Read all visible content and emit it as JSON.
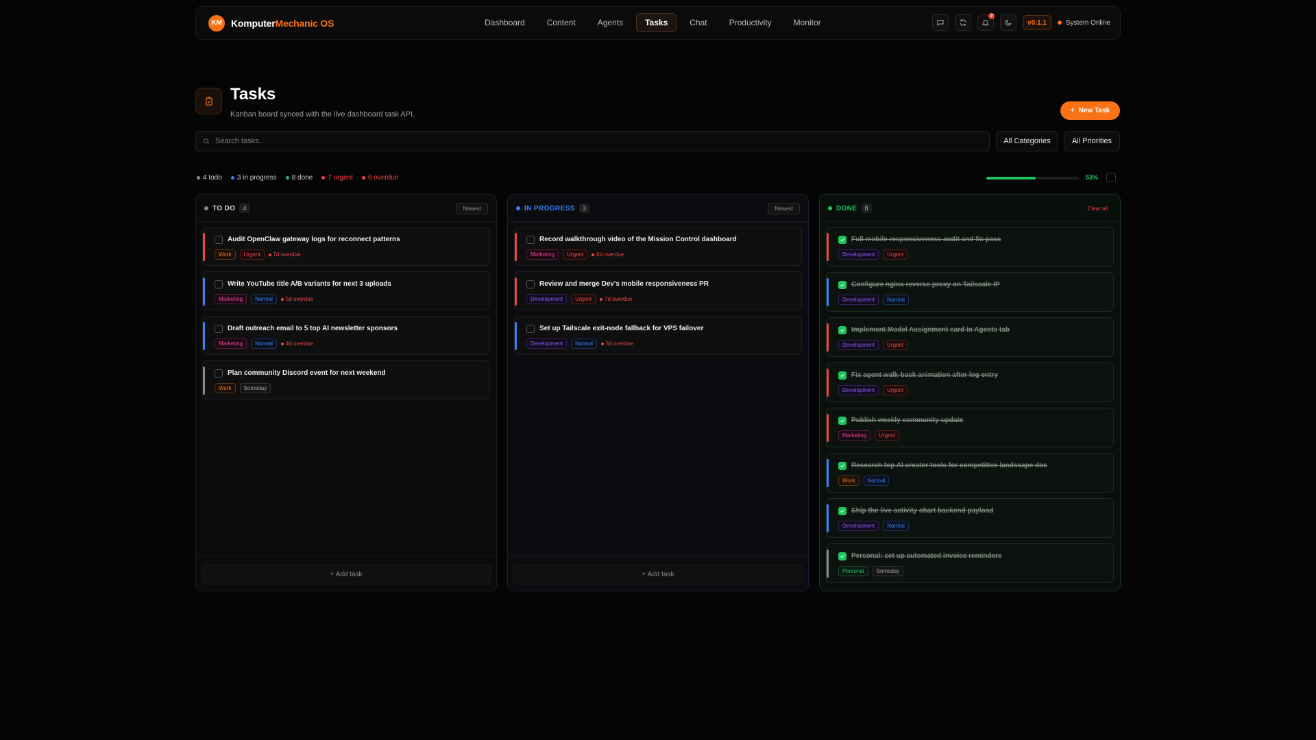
{
  "app": {
    "logo_initials": "KM",
    "title_main": "Komputer",
    "title_accent": "Mechanic OS",
    "version": "v0.1.1",
    "status": "System Online",
    "notification_count": "7"
  },
  "nav": {
    "tabs": [
      {
        "label": "Dashboard",
        "active": false
      },
      {
        "label": "Content",
        "active": false
      },
      {
        "label": "Agents",
        "active": false
      },
      {
        "label": "Tasks",
        "active": true
      },
      {
        "label": "Chat",
        "active": false
      },
      {
        "label": "Productivity",
        "active": false
      },
      {
        "label": "Monitor",
        "active": false
      }
    ],
    "icons": [
      "chat-icon",
      "refresh-icon",
      "bell-icon",
      "moon-icon"
    ]
  },
  "header": {
    "icon": "clipboard-check-icon",
    "title": "Tasks",
    "subtitle": "Kanban board synced with the live dashboard task API.",
    "new_task_label": "New Task"
  },
  "search": {
    "placeholder": "Search tasks..."
  },
  "filters": {
    "categories": "All Categories",
    "priorities": "All Priorities"
  },
  "stats": [
    {
      "label": "4 todo",
      "color": "#8a8a8a",
      "text_color": "#c9c9c9"
    },
    {
      "label": "3 in progress",
      "color": "#3b82f6",
      "text_color": "#c9c9c9"
    },
    {
      "label": "8 done",
      "color": "#22c55e",
      "text_color": "#c9c9c9"
    },
    {
      "label": "7 urgent",
      "color": "#ef4444",
      "text_color": "#ef4444"
    },
    {
      "label": "6 overdue",
      "color": "#ef4444",
      "text_color": "#ef4444"
    }
  ],
  "progress": {
    "percent_label": "53%",
    "fraction": 0.53
  },
  "colors": {
    "accent": "#f97316",
    "urgent": "#ef4444",
    "normal": "#3b82f6",
    "someday": "#8a8a8a",
    "done": "#22c55e"
  },
  "tag_styles": {
    "Work": {
      "color": "#f97316",
      "border": "#5a3616",
      "bg": "#1c1109"
    },
    "Urgent": {
      "color": "#ef4444",
      "border": "#5a1d1d",
      "bg": "#1a0b0b"
    },
    "Marketing": {
      "color": "#ec4899",
      "border": "#5a1d3d",
      "bg": "#1a0a13"
    },
    "Normal": {
      "color": "#3b82f6",
      "border": "#1d325a",
      "bg": "#0a111d"
    },
    "Someday": {
      "color": "#a3a3a3",
      "border": "#333333",
      "bg": "#151515"
    },
    "Development": {
      "color": "#8b5cf6",
      "border": "#35235e",
      "bg": "#110c1d"
    },
    "Personal": {
      "color": "#22c55e",
      "border": "#1a4a2c",
      "bg": "#0b1a11"
    }
  },
  "columns": [
    {
      "id": "todo",
      "title": "TO DO",
      "count": "4",
      "dot": "#8a8a8a",
      "title_color": "#d8d8d8",
      "action": "Newest",
      "action_type": "sort",
      "add_label": "+ Add task",
      "cards": [
        {
          "title": "Audit OpenClaw gateway logs for reconnect patterns",
          "bar": "#ef4444",
          "done": false,
          "tags": [
            "Work",
            "Urgent"
          ],
          "overdue": "7d overdue"
        },
        {
          "title": "Write YouTube title A/B variants for next 3 uploads",
          "bar": "#3b82f6",
          "done": false,
          "tags": [
            "Marketing",
            "Normal"
          ],
          "overdue": "5d overdue"
        },
        {
          "title": "Draft outreach email to 5 top AI newsletter sponsors",
          "bar": "#3b82f6",
          "done": false,
          "tags": [
            "Marketing",
            "Normal"
          ],
          "overdue": "4d overdue"
        },
        {
          "title": "Plan community Discord event for next weekend",
          "bar": "#8a8a8a",
          "done": false,
          "tags": [
            "Work",
            "Someday"
          ],
          "overdue": ""
        }
      ]
    },
    {
      "id": "in-progress",
      "title": "IN PROGRESS",
      "count": "3",
      "dot": "#3b82f6",
      "title_color": "#3b82f6",
      "action": "Newest",
      "action_type": "sort",
      "add_label": "+ Add task",
      "cards": [
        {
          "title": "Record walkthrough video of the Mission Control dashboard",
          "bar": "#ef4444",
          "done": false,
          "tags": [
            "Marketing",
            "Urgent"
          ],
          "overdue": "6d overdue"
        },
        {
          "title": "Review and merge Dev's mobile responsiveness PR",
          "bar": "#ef4444",
          "done": false,
          "tags": [
            "Development",
            "Urgent"
          ],
          "overdue": "7d overdue"
        },
        {
          "title": "Set up Tailscale exit-node fallback for VPS failover",
          "bar": "#3b82f6",
          "done": false,
          "tags": [
            "Development",
            "Normal"
          ],
          "overdue": "5d overdue"
        }
      ]
    },
    {
      "id": "done",
      "title": "DONE",
      "count": "8",
      "dot": "#22c55e",
      "title_color": "#22c55e",
      "action": "Clear all",
      "action_type": "clear",
      "add_label": "",
      "cards": [
        {
          "title": "Full mobile responsiveness audit and fix pass",
          "bar": "#ef4444",
          "done": true,
          "tags": [
            "Development",
            "Urgent"
          ],
          "overdue": ""
        },
        {
          "title": "Configure nginx reverse proxy on Tailscale IP",
          "bar": "#3b82f6",
          "done": true,
          "tags": [
            "Development",
            "Normal"
          ],
          "overdue": ""
        },
        {
          "title": "Implement Model Assignment card in Agents tab",
          "bar": "#ef4444",
          "done": true,
          "tags": [
            "Development",
            "Urgent"
          ],
          "overdue": ""
        },
        {
          "title": "Fix agent walk-back animation after log entry",
          "bar": "#ef4444",
          "done": true,
          "tags": [
            "Development",
            "Urgent"
          ],
          "overdue": ""
        },
        {
          "title": "Publish weekly community update",
          "bar": "#ef4444",
          "done": true,
          "tags": [
            "Marketing",
            "Urgent"
          ],
          "overdue": ""
        },
        {
          "title": "Research top AI creator tools for competitive landscape doc",
          "bar": "#3b82f6",
          "done": true,
          "tags": [
            "Work",
            "Normal"
          ],
          "overdue": ""
        },
        {
          "title": "Ship the live activity chart backend payload",
          "bar": "#3b82f6",
          "done": true,
          "tags": [
            "Development",
            "Normal"
          ],
          "overdue": ""
        },
        {
          "title": "Personal: set up automated invoice reminders",
          "bar": "#8a8a8a",
          "done": true,
          "tags": [
            "Personal",
            "Someday"
          ],
          "overdue": ""
        }
      ]
    }
  ]
}
